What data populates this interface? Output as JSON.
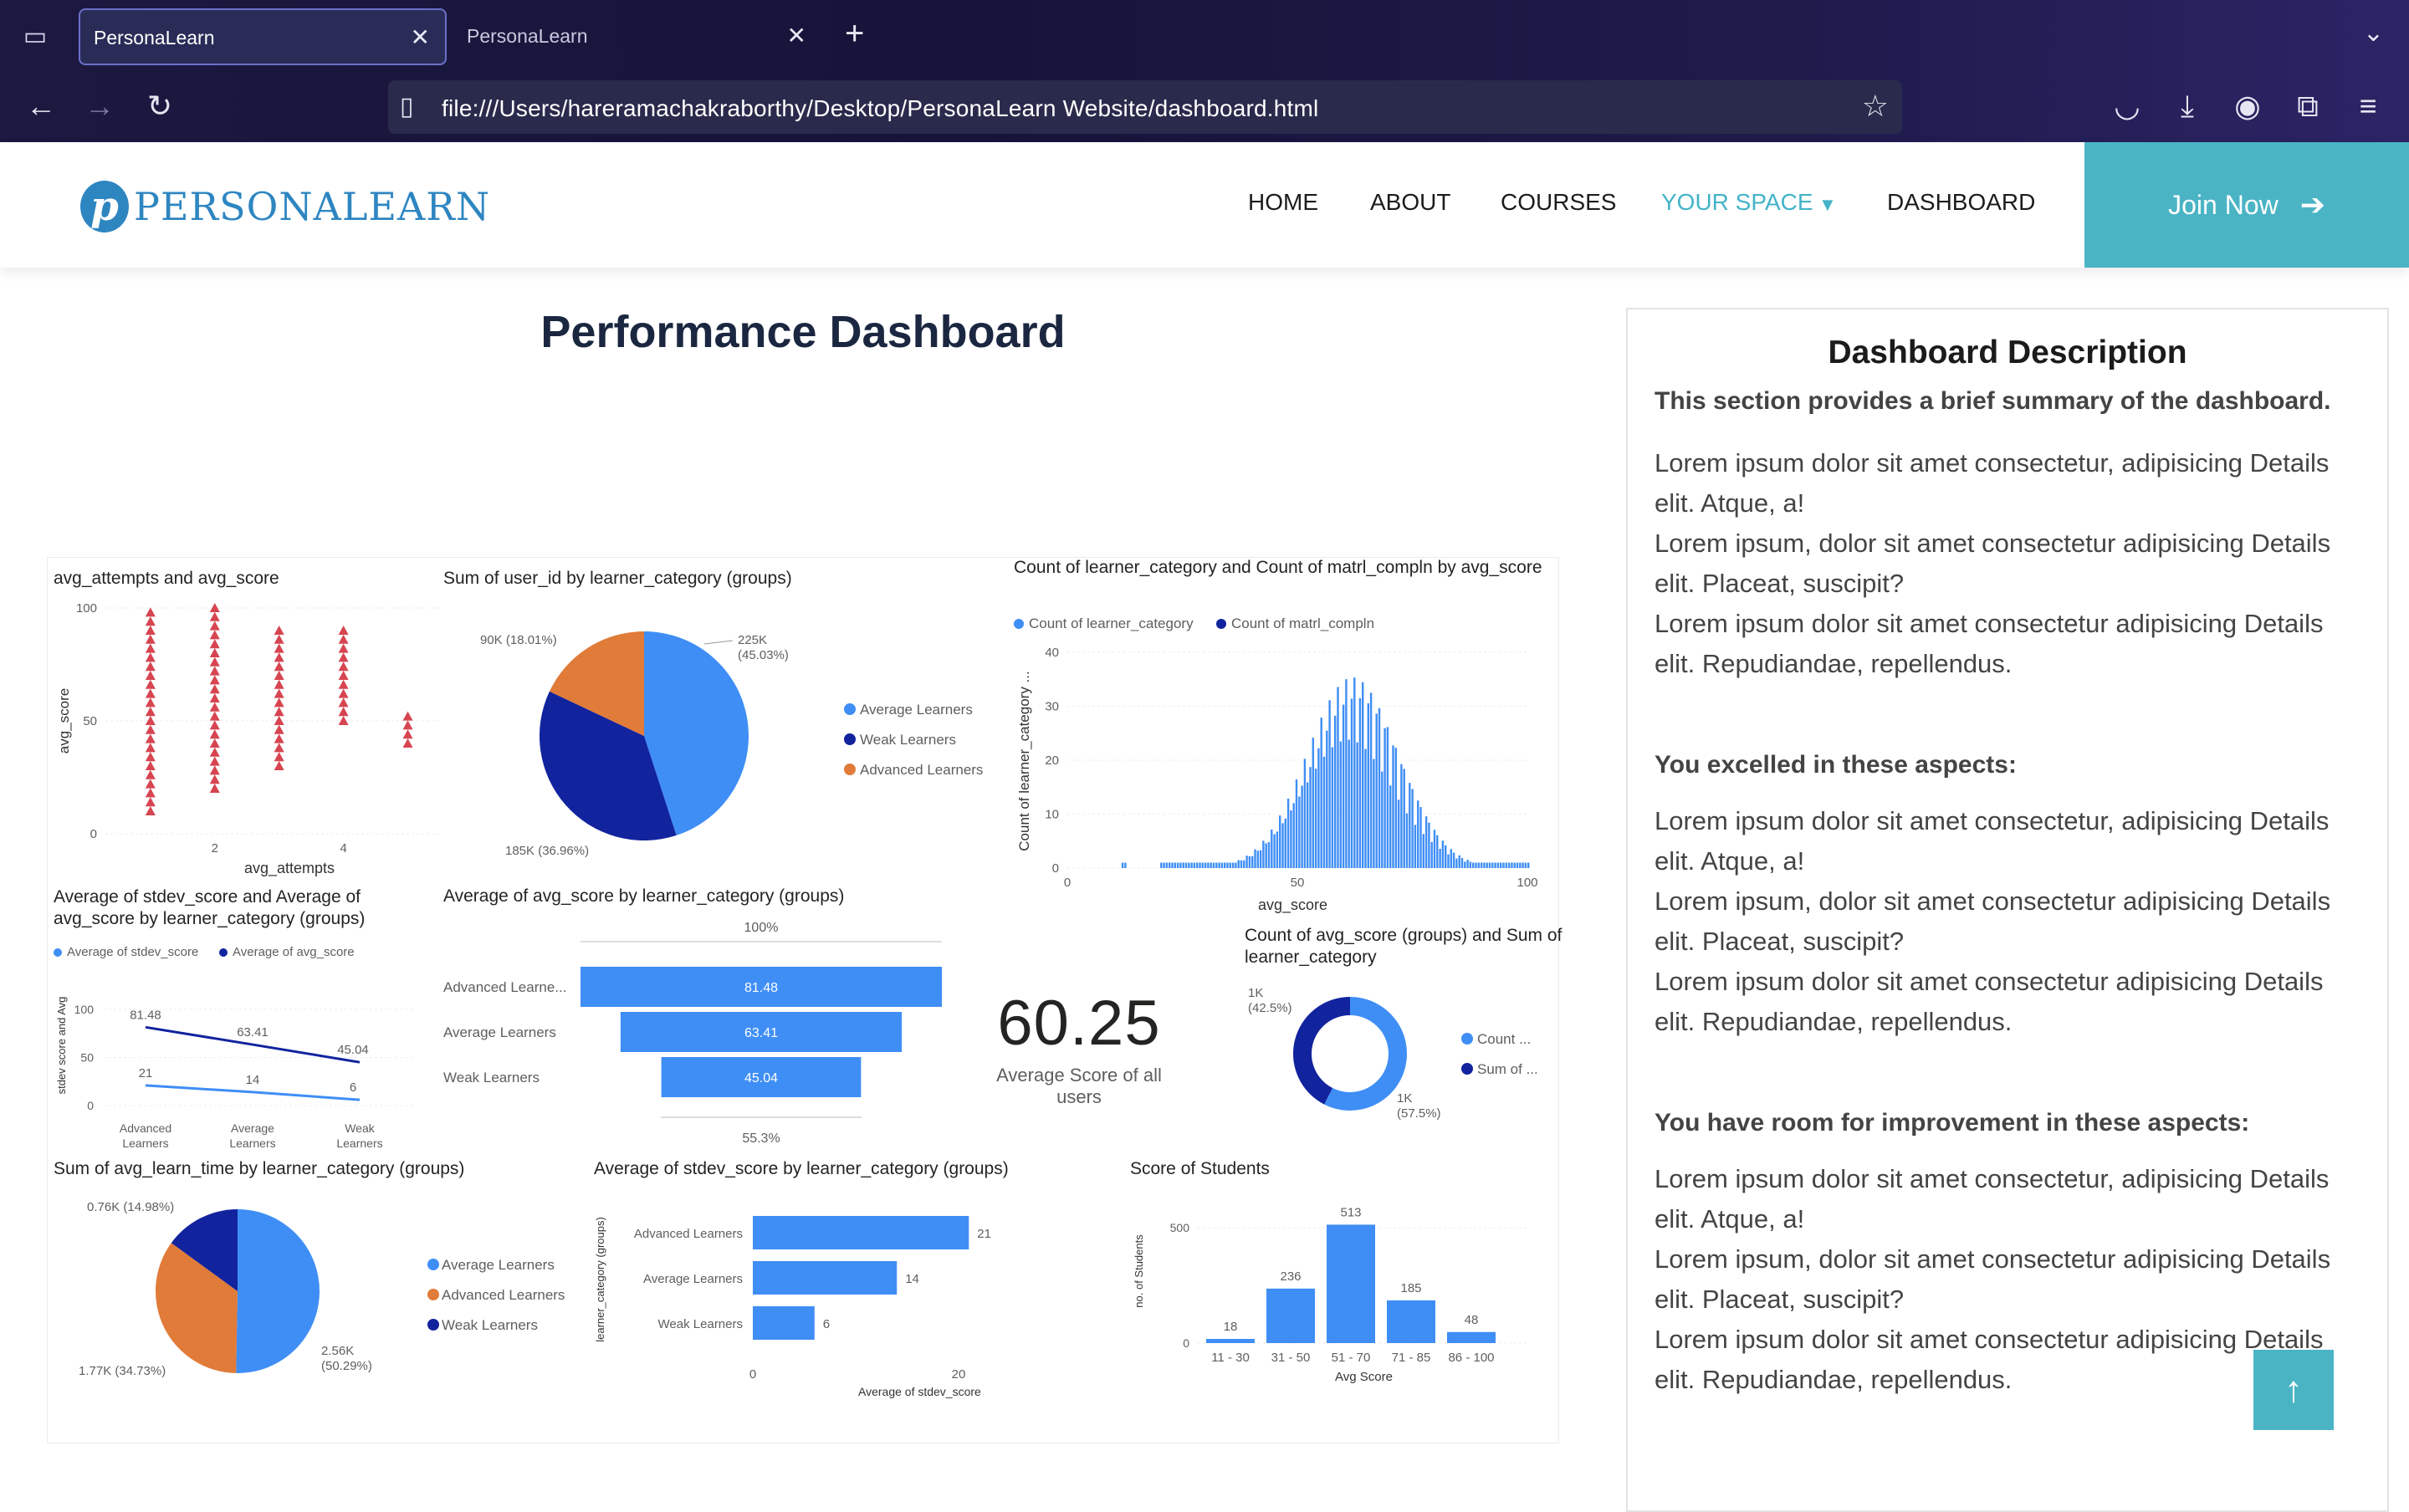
{
  "browser": {
    "tabs": [
      {
        "title": "PersonaLearn"
      },
      {
        "title": "PersonaLearn"
      }
    ],
    "url": "file:///Users/hareramachakraborthy/Desktop/PersonaLearn Website/dashboard.html"
  },
  "header": {
    "logo_text": "PERSONALEARN",
    "menu": [
      "HOME",
      "ABOUT",
      "COURSES",
      "YOUR SPACE",
      "DASHBOARD"
    ],
    "join_label": "Join Now"
  },
  "dashboard": {
    "title": "Performance Dashboard",
    "kpi": {
      "value": "60.25",
      "label": "Average Score of all users"
    }
  },
  "colors": {
    "accent": "#4ab4c5",
    "blue": "#3f8ef5",
    "navy": "#12239e",
    "orange": "#e07b39",
    "red": "#d64550"
  },
  "chart_data": [
    {
      "type": "scatter",
      "title": "avg_attempts and avg_score",
      "xlabel": "avg_attempts",
      "ylabel": "avg_score",
      "xticks": [
        "2",
        "4"
      ],
      "yticks": [
        "0",
        "50",
        "100"
      ],
      "series": [
        {
          "values": [
            [
              1,
              10
            ],
            [
              1,
              100
            ],
            [
              2,
              20
            ],
            [
              2,
              100
            ],
            [
              3,
              30
            ],
            [
              3,
              90
            ],
            [
              4,
              50
            ],
            [
              4,
              90
            ],
            [
              5,
              40
            ],
            [
              5,
              55
            ]
          ]
        }
      ]
    },
    {
      "type": "pie",
      "title": "Sum of user_id by learner_category (groups)",
      "legend": [
        "Average Learners",
        "Weak Learners",
        "Advanced Learners"
      ],
      "slices": [
        {
          "name": "Average Learners",
          "value": 225,
          "label": "225K\n(45.03%)"
        },
        {
          "name": "Weak Learners",
          "value": 185,
          "label": "185K (36.96%)"
        },
        {
          "name": "Advanced Learners",
          "value": 90,
          "label": "90K (18.01%)"
        }
      ]
    },
    {
      "type": "bar",
      "title": "Count of learner_category and Count of matrl_compln by avg_score",
      "legend": [
        "Count of learner_category",
        "Count of matrl_compln"
      ],
      "xlabel": "avg_score",
      "ylabel": "Count of learner_category ...",
      "xticks": [
        "0",
        "50",
        "100"
      ],
      "yticks": [
        "0",
        "10",
        "20",
        "30",
        "40"
      ]
    },
    {
      "type": "line",
      "title": "Average of stdev_score and Average of avg_score by learner_category (groups)",
      "legend": [
        "Average of stdev_score",
        "Average of avg_score"
      ],
      "ylabel": "stdev score and Avg",
      "categories": [
        "Advanced Learners",
        "Average Learners",
        "Weak Learners"
      ],
      "yticks": [
        "0",
        "50",
        "100"
      ],
      "series": [
        {
          "name": "Average of avg_score",
          "values": [
            81.48,
            63.41,
            45.04
          ]
        },
        {
          "name": "Average of stdev_score",
          "values": [
            21,
            14,
            6
          ]
        }
      ]
    },
    {
      "type": "bar",
      "title": "Average of avg_score by learner_category (groups)",
      "categories": [
        "Advanced Learne...",
        "Average Learners",
        "Weak Learners"
      ],
      "values": [
        81.48,
        63.41,
        45.04
      ],
      "top_label": "100%",
      "bottom_label": "55.3%"
    },
    {
      "type": "pie",
      "title": "Count of avg_score (groups) and Sum of learner_category",
      "legend": [
        "Count ...",
        "Sum of ..."
      ],
      "slices": [
        {
          "name": "Count",
          "value": 57.5,
          "label": "1K\n(57.5%)"
        },
        {
          "name": "Sum",
          "value": 42.5,
          "label": "1K\n(42.5%)"
        }
      ]
    },
    {
      "type": "pie",
      "title": "Sum of avg_learn_time by learner_category (groups)",
      "legend": [
        "Average Learners",
        "Advanced Learners",
        "Weak Learners"
      ],
      "slices": [
        {
          "name": "Average Learners",
          "value": 50.29,
          "label": "2.56K\n(50.29%)"
        },
        {
          "name": "Advanced Learners",
          "value": 34.73,
          "label": "1.77K (34.73%)"
        },
        {
          "name": "Weak Learners",
          "value": 14.98,
          "label": "0.76K (14.98%)"
        }
      ]
    },
    {
      "type": "bar",
      "title": "Average of stdev_score by learner_category (groups)",
      "categories": [
        "Advanced Learners",
        "Average Learners",
        "Weak Learners"
      ],
      "values": [
        21,
        14,
        6
      ],
      "xlabel": "Average of stdev_score",
      "ylabel": "learner_category (groups)",
      "xticks": [
        "0",
        "20"
      ]
    },
    {
      "type": "bar",
      "title": "Score of Students",
      "categories": [
        "11 - 30",
        "31 - 50",
        "51 - 70",
        "71 - 85",
        "86 - 100"
      ],
      "values": [
        18,
        236,
        513,
        185,
        48
      ],
      "xlabel": "Avg Score",
      "ylabel": "no. of Students",
      "yticks": [
        "0",
        "500"
      ]
    }
  ],
  "description": {
    "title": "Dashboard Description",
    "lead": "This section provides a brief summary of the dashboard.",
    "intro_lines": [
      "Lorem ipsum dolor sit amet consectetur, adipisicing Details elit. Atque, a!",
      "Lorem ipsum, dolor sit amet consectetur adipisicing Details elit. Placeat, suscipit?",
      "Lorem ipsum dolor sit amet consectetur adipisicing  Details elit. Repudiandae, repellendus."
    ],
    "excelled_title": "You excelled in these aspects:",
    "improve_title": "You have room for improvement in these aspects:"
  }
}
